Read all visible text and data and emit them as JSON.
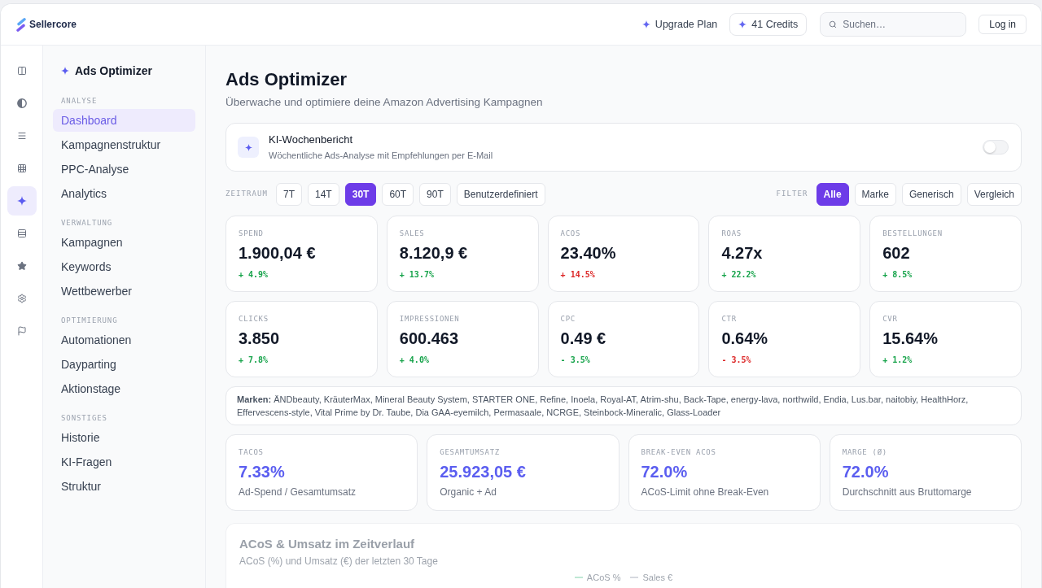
{
  "header": {
    "brand": "Sellercore",
    "upgrade_link": "Upgrade Plan",
    "credits_button": "41 Credits",
    "search": {
      "placeholder": "Suchen…"
    },
    "login_button": "Log in"
  },
  "icon_rail": [
    {
      "selected": false
    },
    {
      "selected": false
    },
    {
      "selected": false
    },
    {
      "selected": false
    },
    {
      "selected": true
    },
    {
      "selected": false
    },
    {
      "selected": false
    },
    {
      "selected": false
    },
    {
      "selected": false
    }
  ],
  "sidebar": {
    "title": "Ads Optimizer",
    "sections": [
      {
        "heading": "ANALYSE",
        "items": [
          {
            "label": "Dashboard",
            "selected": true
          },
          {
            "label": "Kampagnenstruktur",
            "selected": false
          },
          {
            "label": "PPC-Analyse",
            "selected": false
          },
          {
            "label": "Analytics",
            "selected": false
          }
        ]
      },
      {
        "heading": "VERWALTUNG",
        "items": [
          {
            "label": "Kampagnen",
            "selected": false
          },
          {
            "label": "Keywords",
            "selected": false
          },
          {
            "label": "Wettbewerber",
            "selected": false
          }
        ]
      },
      {
        "heading": "OPTIMIERUNG",
        "items": [
          {
            "label": "Automationen",
            "selected": false
          },
          {
            "label": "Dayparting",
            "selected": false
          },
          {
            "label": "Aktionstage",
            "selected": false
          }
        ]
      },
      {
        "heading": "SONSTIGES",
        "items": [
          {
            "label": "Historie",
            "selected": false
          },
          {
            "label": "KI-Fragen",
            "selected": false
          },
          {
            "label": "Struktur",
            "selected": false
          }
        ]
      }
    ]
  },
  "page": {
    "title": "Ads Optimizer",
    "subtitle": "Überwache und optimiere deine Amazon Advertising Kampagnen"
  },
  "report_card": {
    "title": "KI-Wochenbericht",
    "description": "Wöchentliche Ads-Analyse mit Empfehlungen per E-Mail",
    "on": false
  },
  "period": {
    "label": "ZEITRAUM",
    "options": [
      {
        "label": "7T",
        "selected": false
      },
      {
        "label": "14T",
        "selected": false
      },
      {
        "label": "30T",
        "selected": true
      },
      {
        "label": "60T",
        "selected": false
      },
      {
        "label": "90T",
        "selected": false
      },
      {
        "label": "Benutzerdefiniert",
        "selected": false
      }
    ]
  },
  "filter": {
    "label": "FILTER",
    "options": [
      {
        "label": "Alle",
        "selected": true
      },
      {
        "label": "Marke",
        "selected": false
      },
      {
        "label": "Generisch",
        "selected": false
      },
      {
        "label": "Vergleich",
        "selected": false
      }
    ]
  },
  "kpis": [
    {
      "label": "SPEND",
      "value": "1.900,04 €",
      "change": "+ 4.9%",
      "color": "#16a34a"
    },
    {
      "label": "SALES",
      "value": "8.120,9 €",
      "change": "+ 13.7%",
      "color": "#16a34a"
    },
    {
      "label": "ACOS",
      "value": "23.40%",
      "change": "+ 14.5%",
      "color": "#dc2626"
    },
    {
      "label": "ROAS",
      "value": "4.27x",
      "change": "+ 22.2%",
      "color": "#16a34a"
    },
    {
      "label": "BESTELLUNGEN",
      "value": "602",
      "change": "+ 8.5%",
      "color": "#16a34a"
    },
    {
      "label": "CLICKS",
      "value": "3.850",
      "change": "+ 7.8%",
      "color": "#16a34a"
    },
    {
      "label": "IMPRESSIONEN",
      "value": "600.463",
      "change": "+ 4.0%",
      "color": "#16a34a"
    },
    {
      "label": "CPC",
      "value": "0.49 €",
      "change": "- 3.5%",
      "color": "#16a34a"
    },
    {
      "label": "CTR",
      "value": "0.64%",
      "change": "- 3.5%",
      "color": "#dc2626"
    },
    {
      "label": "CVR",
      "value": "15.64%",
      "change": "+ 1.2%",
      "color": "#16a34a"
    }
  ],
  "brands": "**Marken:** ÄNDbeauty, KräuterMax, Mineral Beauty System, STARTER ONE, Refine, Inoela, Royal-AT, Atrim-shu, Back-Tape, energy-lava, northwild, Endia, Lus.bar, naitobiy, HealthHorz, Effervescens-style, Vital Prime by Dr. Taube, Dia GAA-eyemilch, Permasaale, NCRGE, Steinbock-Mineralic, Glass-Loader",
  "summary_cards": [
    {
      "label": "TACOS",
      "value": "7.33%",
      "note": "Ad-Spend / Gesamtumsatz"
    },
    {
      "label": "GESAMTUMSATZ",
      "value": "25.923,05 €",
      "note": "Organic + Ad"
    },
    {
      "label": "BREAK-EVEN ACOS",
      "value": "72.0%",
      "note": "ACoS-Limit ohne Break-Even"
    },
    {
      "label": "MARGE (Ø)",
      "value": "72.0%",
      "note": "Durchschnitt aus Bruttomarge"
    }
  ],
  "chart_card": {
    "title": "ACoS & Umsatz im Zeitverlauf",
    "subtitle": "ACoS (%) und Umsatz (€) der letzten 30 Tage",
    "legend": [
      {
        "label": "ACoS %",
        "color": "#bfe8d4"
      },
      {
        "label": "Sales €",
        "color": "#d6d9df"
      }
    ]
  }
}
